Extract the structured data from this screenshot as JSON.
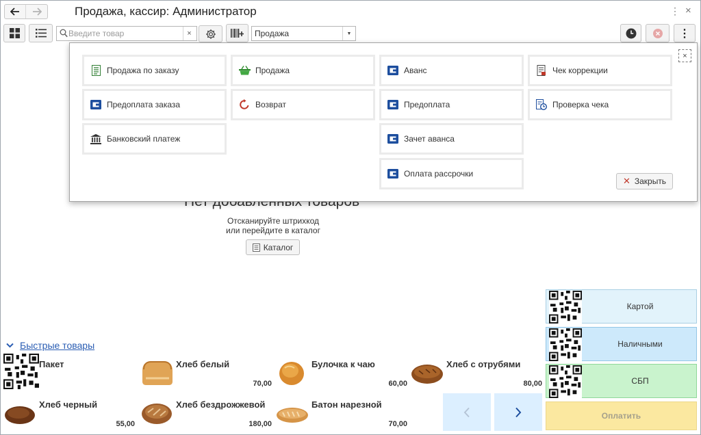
{
  "window": {
    "title": "Продажа, кассир: Администратор",
    "menu_glyph": "⋮",
    "close_glyph": "×"
  },
  "nav": {
    "back": "🡐",
    "forward": "🡒"
  },
  "toolbar": {
    "search_placeholder": "Введите товар",
    "search_clear": "×",
    "mode_value": "Продажа",
    "more_glyph": "⋮"
  },
  "empty_state": {
    "title": "Нет добавленных товаров",
    "hint_line1": "Отсканируйте штрихкод",
    "hint_line2": "или перейдите в каталог",
    "catalog_label": "Каталог"
  },
  "popup": {
    "close_glyph": "×",
    "operations": [
      {
        "label": "Продажа по заказу",
        "icon": "order-doc-icon"
      },
      {
        "label": "Продажа",
        "icon": "basket-icon"
      },
      {
        "label": "Аванс",
        "icon": "wallet-icon"
      },
      {
        "label": "Чек коррекции",
        "icon": "receipt-correction-icon"
      },
      {
        "label": "Предоплата заказа",
        "icon": "wallet-icon"
      },
      {
        "label": "Возврат",
        "icon": "return-arrow-icon"
      },
      {
        "label": "Предоплата",
        "icon": "wallet-icon"
      },
      {
        "label": "Проверка чека",
        "icon": "receipt-check-icon"
      },
      {
        "label": "Банковский платеж",
        "icon": "bank-icon"
      },
      {
        "label": "Зачет аванса",
        "icon": "wallet-icon"
      },
      {
        "label": "Оплата рассрочки",
        "icon": "wallet-icon"
      }
    ],
    "close_label": "Закрыть",
    "close_icon_glyph": "✕"
  },
  "quick": {
    "title": "Быстрые товары",
    "items": [
      {
        "name": "Пакет",
        "price": "",
        "image": "qr-code"
      },
      {
        "name": "Хлеб белый",
        "price": "70,00",
        "image": "white-bread"
      },
      {
        "name": "Булочка к чаю",
        "price": "60,00",
        "image": "bun"
      },
      {
        "name": "Хлеб с отрубями",
        "price": "80,00",
        "image": "bran-bread"
      },
      {
        "name": "Хлеб черный",
        "price": "55,00",
        "image": "black-bread"
      },
      {
        "name": "Хлеб бездрожжевой",
        "price": "180,00",
        "image": "yeast-free-bread"
      },
      {
        "name": "Батон нарезной",
        "price": "70,00",
        "image": "loaf"
      }
    ],
    "prev_glyph": "‹",
    "next_glyph": "›"
  },
  "payment": {
    "card": "Картой",
    "cash": "Наличными",
    "sbp": "СБП",
    "pay": "Оплатить",
    "colors": {
      "card": "#e2f3fb",
      "cash": "#cde9fb",
      "sbp": "#c9f3cd",
      "pay": "#fbe8a0"
    }
  }
}
